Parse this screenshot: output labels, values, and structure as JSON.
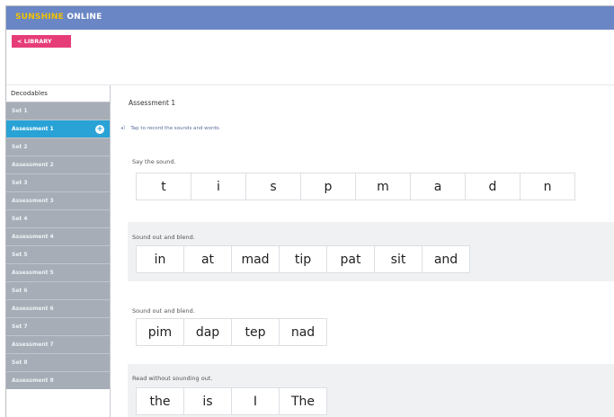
{
  "brand": {
    "part1": "SUNSHINE",
    "part2": "ONLINE"
  },
  "library_button": "< LIBRARY",
  "sidebar": {
    "heading": "Decodables",
    "items": [
      {
        "label": "Set 1",
        "active": false
      },
      {
        "label": "Assessment 1",
        "active": true
      },
      {
        "label": "Set 2",
        "active": false
      },
      {
        "label": "Assessment 2",
        "active": false
      },
      {
        "label": "Set 3",
        "active": false
      },
      {
        "label": "Assessment 3",
        "active": false
      },
      {
        "label": "Set 4",
        "active": false
      },
      {
        "label": "Assessment 4",
        "active": false
      },
      {
        "label": "Set 5",
        "active": false
      },
      {
        "label": "Assessment 5",
        "active": false
      },
      {
        "label": "Set 6",
        "active": false
      },
      {
        "label": "Assessment 6",
        "active": false
      },
      {
        "label": "Set 7",
        "active": false
      },
      {
        "label": "Assessment 7",
        "active": false
      },
      {
        "label": "Set 8",
        "active": false
      },
      {
        "label": "Assessment 8",
        "active": false
      }
    ]
  },
  "main": {
    "title": "Assessment 1",
    "hint": "Tap to record the sounds and words.",
    "sections": [
      {
        "label": "Say the sound.",
        "tiles": [
          "t",
          "i",
          "s",
          "p",
          "m",
          "a",
          "d",
          "n"
        ]
      },
      {
        "label": "Sound out and blend.",
        "tiles": [
          "in",
          "at",
          "mad",
          "tip",
          "pat",
          "sit",
          "and"
        ]
      },
      {
        "label": "Sound out and blend.",
        "tiles": [
          "pim",
          "dap",
          "tep",
          "nad"
        ]
      },
      {
        "label": "Read without sounding out.",
        "tiles": [
          "the",
          "is",
          "I",
          "The"
        ]
      }
    ]
  },
  "colors": {
    "topbar": "#6a86c4",
    "brand_accent": "#f2c200",
    "library_button": "#e63d78",
    "sidebar_item": "#a6adb6",
    "sidebar_active": "#29a2d6"
  }
}
